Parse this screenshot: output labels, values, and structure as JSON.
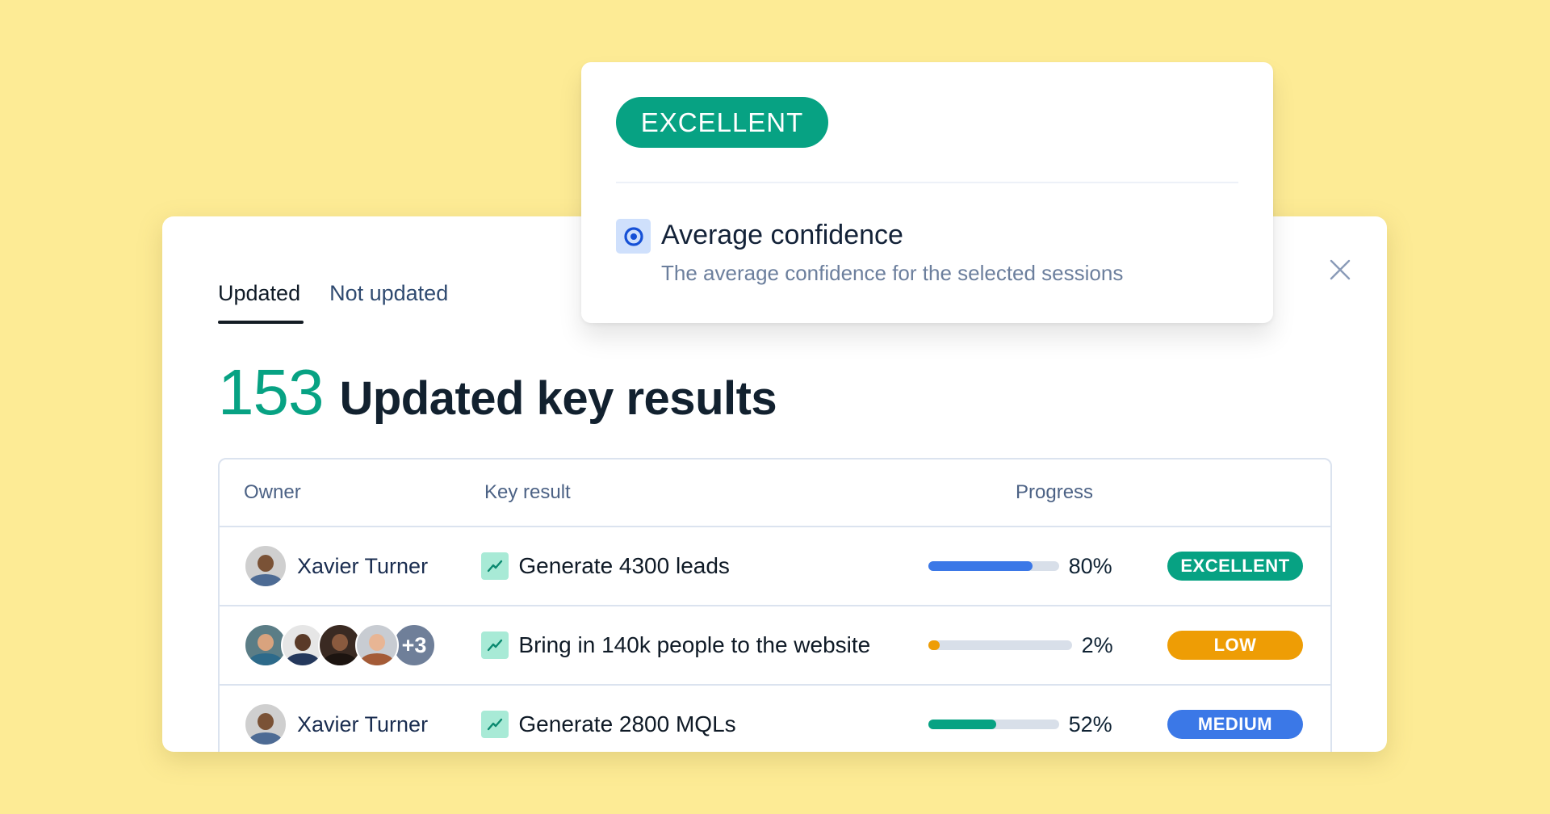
{
  "panel": {
    "tabs": [
      {
        "label": "Updated",
        "active": true
      },
      {
        "label": "Not updated",
        "active": false
      }
    ],
    "count": "153",
    "title": "Updated key results",
    "close_icon": "close-icon"
  },
  "table": {
    "headers": {
      "owner": "Owner",
      "key_result": "Key result",
      "progress": "Progress"
    },
    "rows": [
      {
        "owner": "Xavier Turner",
        "owners_extra": null,
        "key_result": "Generate 4300 leads",
        "progress": 80,
        "progress_label": "80%",
        "progress_color": "#3b78e7",
        "status": "EXCELLENT",
        "status_color": "#07a283"
      },
      {
        "owner": "",
        "owners_extra": "+3",
        "key_result": "Bring in 140k people to the website",
        "progress": 2,
        "progress_label": "2%",
        "progress_color": "#ee9d05",
        "status": "LOW",
        "status_color": "#ee9d05"
      },
      {
        "owner": "Xavier Turner",
        "owners_extra": null,
        "key_result": "Generate 2800 MQLs",
        "progress": 52,
        "progress_label": "52%",
        "progress_color": "#07a283",
        "status": "MEDIUM",
        "status_color": "#3b78e7"
      }
    ]
  },
  "popup": {
    "badge": "EXCELLENT",
    "badge_color": "#07a283",
    "icon": "target-icon",
    "title": "Average confidence",
    "description": "The average confidence for the selected sessions"
  }
}
